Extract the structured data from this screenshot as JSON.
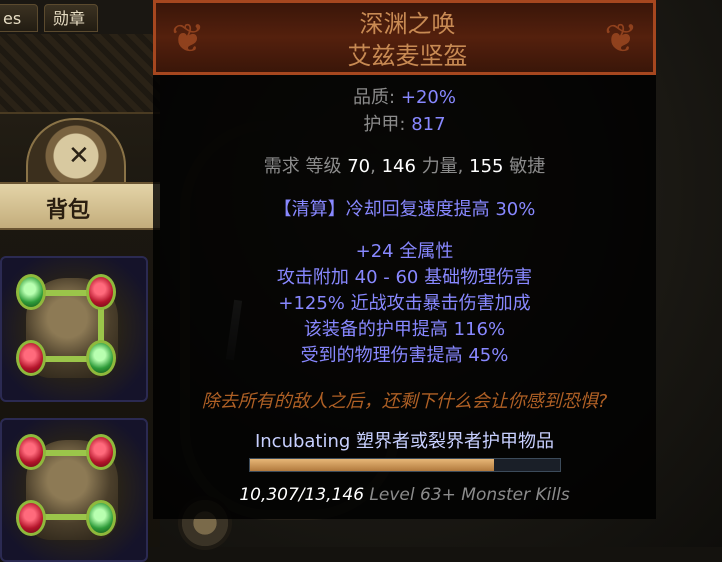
{
  "tabs": [
    {
      "label": "es"
    },
    {
      "label": "勋章"
    }
  ],
  "inventory": {
    "banner_label": "背包"
  },
  "item": {
    "name": "深渊之唤",
    "base": "艾兹麦坚盔",
    "quality_label": "品质:",
    "quality_value": "+20%",
    "armour_label": "护甲:",
    "armour_value": "817",
    "requirements": {
      "prefix": "需求 等级",
      "level": "70",
      "sep1": ",",
      "str": "146",
      "str_label": "力量,",
      "dex": "155",
      "dex_label": "敏捷"
    },
    "enchant": "【清算】冷却回复速度提高 30%",
    "mods": [
      "+24 全属性",
      "攻击附加 40 - 60 基础物理伤害",
      "+125% 近战攻击暴击伤害加成",
      "该装备的护甲提高 116%",
      "受到的物理伤害提高 45%"
    ],
    "flavour": "除去所有的敌人之后，还剩下什么会让你感到恐惧?",
    "incubation": {
      "label": "Incubating 塑界者或裂界者护甲物品",
      "progress_fraction": 0.7855,
      "count": "10,307/13,146",
      "requirement": "Level 63+ Monster Kills"
    }
  },
  "colors": {
    "unique_name": "#c88a53",
    "magic_mod": "#8888ff",
    "flavour": "#af6025",
    "header_border": "#a6471f"
  }
}
